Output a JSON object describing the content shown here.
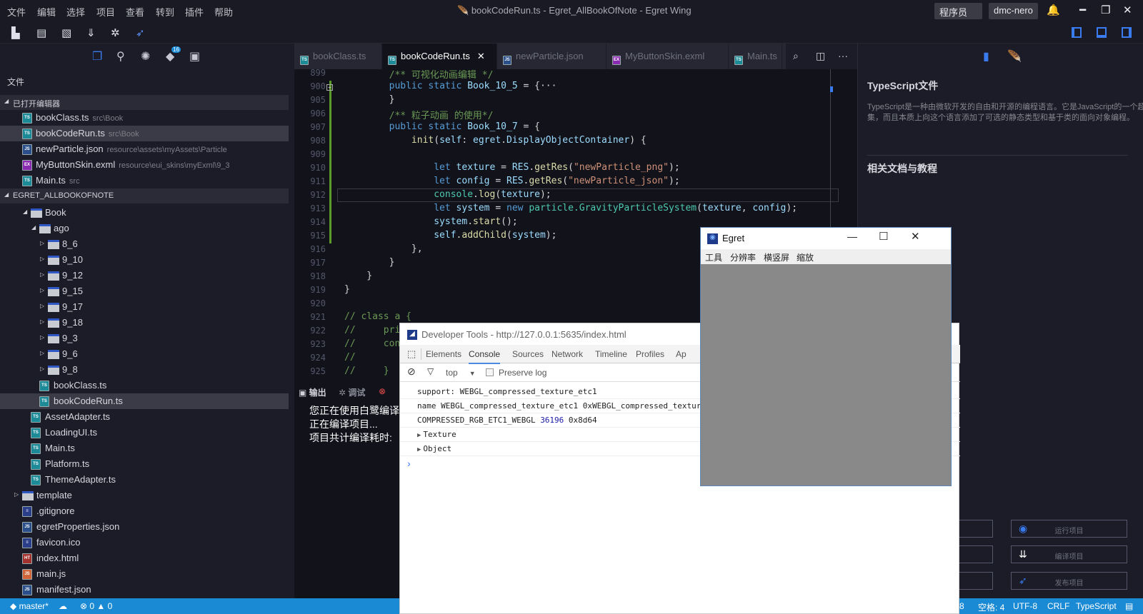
{
  "window": {
    "title": "bookCodeRun.ts - Egret_AllBookOfNote - Egret Wing",
    "menu": [
      "文件",
      "编辑",
      "选择",
      "项目",
      "查看",
      "转到",
      "插件",
      "帮助"
    ],
    "role_select": "程序员",
    "user": "dmc-nero"
  },
  "toolbar": {
    "icons": [
      "new-project-icon",
      "save-icon",
      "save-all-icon",
      "build-icon",
      "debug-icon",
      "publish-icon"
    ]
  },
  "activity": {
    "badge": "16"
  },
  "sidebar": {
    "title": "文件",
    "open_editors_header": "已打开编辑器",
    "open_editors": [
      {
        "name": "bookClass.ts",
        "path": "src\\Book",
        "type": "ts"
      },
      {
        "name": "bookCodeRun.ts",
        "path": "src\\Book",
        "type": "ts",
        "selected": true
      },
      {
        "name": "newParticle.json",
        "path": "resource\\assets\\myAssets\\Particle",
        "type": "json"
      },
      {
        "name": "MyButtonSkin.exml",
        "path": "resource\\eui_skins\\myExml\\9_3",
        "type": "exml"
      },
      {
        "name": "Main.ts",
        "path": "src",
        "type": "ts"
      }
    ],
    "project_header": "EGRET_ALLBOOKOFNOTE",
    "tree": [
      {
        "name": "Book",
        "kind": "folder",
        "depth": 1,
        "open": true
      },
      {
        "name": "ago",
        "kind": "folder",
        "depth": 2,
        "open": true
      },
      {
        "name": "8_6",
        "kind": "folder",
        "depth": 3
      },
      {
        "name": "9_10",
        "kind": "folder",
        "depth": 3
      },
      {
        "name": "9_12",
        "kind": "folder",
        "depth": 3
      },
      {
        "name": "9_15",
        "kind": "folder",
        "depth": 3
      },
      {
        "name": "9_17",
        "kind": "folder",
        "depth": 3
      },
      {
        "name": "9_18",
        "kind": "folder",
        "depth": 3
      },
      {
        "name": "9_3",
        "kind": "folder",
        "depth": 3
      },
      {
        "name": "9_6",
        "kind": "folder",
        "depth": 3
      },
      {
        "name": "9_8",
        "kind": "folder",
        "depth": 3
      },
      {
        "name": "bookClass.ts",
        "kind": "ts",
        "depth": 2
      },
      {
        "name": "bookCodeRun.ts",
        "kind": "ts",
        "depth": 2,
        "selected": true
      },
      {
        "name": "AssetAdapter.ts",
        "kind": "ts",
        "depth": 1
      },
      {
        "name": "LoadingUI.ts",
        "kind": "ts",
        "depth": 1
      },
      {
        "name": "Main.ts",
        "kind": "ts",
        "depth": 1
      },
      {
        "name": "Platform.ts",
        "kind": "ts",
        "depth": 1
      },
      {
        "name": "ThemeAdapter.ts",
        "kind": "ts",
        "depth": 1
      },
      {
        "name": "template",
        "kind": "folder",
        "depth": 0
      },
      {
        "name": ".gitignore",
        "kind": "text",
        "depth": 0
      },
      {
        "name": "egretProperties.json",
        "kind": "json",
        "depth": 0
      },
      {
        "name": "favicon.ico",
        "kind": "text",
        "depth": 0
      },
      {
        "name": "index.html",
        "kind": "html",
        "depth": 0
      },
      {
        "name": "main.js",
        "kind": "js",
        "depth": 0
      },
      {
        "name": "manifest.json",
        "kind": "json",
        "depth": 0
      }
    ]
  },
  "tabs": [
    {
      "label": "bookClass.ts",
      "type": "ts"
    },
    {
      "label": "bookCodeRun.ts",
      "type": "ts",
      "active": true,
      "close": "✕"
    },
    {
      "label": "newParticle.json",
      "type": "json"
    },
    {
      "label": "MyButtonSkin.exml",
      "type": "exml"
    },
    {
      "label": "Main.ts",
      "type": "ts"
    }
  ],
  "code": [
    {
      "n": "899",
      "t": [
        [
          "p",
          "        "
        ],
        [
          "c",
          "/** 可视化动画编辑 */"
        ]
      ]
    },
    {
      "n": "900",
      "fold": true,
      "t": [
        [
          "p",
          "        "
        ],
        [
          "k",
          "public static "
        ],
        [
          "i",
          "Book_10_5"
        ],
        [
          "p",
          " = {···"
        ]
      ]
    },
    {
      "n": "905",
      "t": [
        [
          "p",
          "        }"
        ]
      ]
    },
    {
      "n": "906",
      "t": [
        [
          "p",
          "        "
        ],
        [
          "c",
          "/** 粒子动画 的使用*/"
        ]
      ]
    },
    {
      "n": "907",
      "t": [
        [
          "p",
          "        "
        ],
        [
          "k",
          "public static "
        ],
        [
          "i",
          "Book_10_7"
        ],
        [
          "p",
          " = {"
        ]
      ]
    },
    {
      "n": "908",
      "t": [
        [
          "p",
          "            "
        ],
        [
          "f",
          "init"
        ],
        [
          "p",
          "("
        ],
        [
          "i",
          "self"
        ],
        [
          "p",
          ": "
        ],
        [
          "i",
          "egret"
        ],
        [
          "p",
          "."
        ],
        [
          "i",
          "DisplayObjectContainer"
        ],
        [
          "p",
          ") {"
        ]
      ]
    },
    {
      "n": "909",
      "t": []
    },
    {
      "n": "910",
      "t": [
        [
          "p",
          "                "
        ],
        [
          "k",
          "let "
        ],
        [
          "i",
          "texture"
        ],
        [
          "p",
          " = "
        ],
        [
          "i",
          "RES"
        ],
        [
          "p",
          "."
        ],
        [
          "f",
          "getRes"
        ],
        [
          "p",
          "("
        ],
        [
          "s",
          "\"newParticle_png\""
        ],
        [
          "p",
          ");"
        ]
      ]
    },
    {
      "n": "911",
      "t": [
        [
          "p",
          "                "
        ],
        [
          "k",
          "let "
        ],
        [
          "i",
          "config"
        ],
        [
          "p",
          " = "
        ],
        [
          "i",
          "RES"
        ],
        [
          "p",
          "."
        ],
        [
          "f",
          "getRes"
        ],
        [
          "p",
          "("
        ],
        [
          "s",
          "\"newParticle_json\""
        ],
        [
          "p",
          ");"
        ]
      ]
    },
    {
      "n": "912",
      "current": true,
      "t": [
        [
          "p",
          "                "
        ],
        [
          "t",
          "console"
        ],
        [
          "p",
          "."
        ],
        [
          "f",
          "log"
        ],
        [
          "p",
          "("
        ],
        [
          "i",
          "texture"
        ],
        [
          "p",
          ");"
        ]
      ]
    },
    {
      "n": "913",
      "t": [
        [
          "p",
          "                "
        ],
        [
          "k",
          "let "
        ],
        [
          "i",
          "system"
        ],
        [
          "p",
          " = "
        ],
        [
          "k",
          "new "
        ],
        [
          "t",
          "particle.GravityParticleSystem"
        ],
        [
          "p",
          "("
        ],
        [
          "i",
          "texture"
        ],
        [
          "p",
          ", "
        ],
        [
          "i",
          "config"
        ],
        [
          "p",
          ");"
        ]
      ]
    },
    {
      "n": "914",
      "t": [
        [
          "p",
          "                "
        ],
        [
          "i",
          "system"
        ],
        [
          "p",
          "."
        ],
        [
          "f",
          "start"
        ],
        [
          "p",
          "();"
        ]
      ]
    },
    {
      "n": "915",
      "t": [
        [
          "p",
          "                "
        ],
        [
          "i",
          "self"
        ],
        [
          "p",
          "."
        ],
        [
          "f",
          "addChild"
        ],
        [
          "p",
          "("
        ],
        [
          "i",
          "system"
        ],
        [
          "p",
          ");"
        ]
      ]
    },
    {
      "n": "916",
      "t": [
        [
          "p",
          "            },"
        ]
      ]
    },
    {
      "n": "917",
      "t": [
        [
          "p",
          "        }"
        ]
      ]
    },
    {
      "n": "918",
      "t": [
        [
          "p",
          "    }"
        ]
      ]
    },
    {
      "n": "919",
      "t": [
        [
          "p",
          "}"
        ]
      ]
    },
    {
      "n": "920",
      "t": []
    },
    {
      "n": "921",
      "t": [
        [
          "c",
          "// class a {"
        ]
      ]
    },
    {
      "n": "922",
      "t": [
        [
          "c",
          "//     pri"
        ]
      ]
    },
    {
      "n": "923",
      "t": [
        [
          "c",
          "//     con"
        ]
      ]
    },
    {
      "n": "924",
      "t": [
        [
          "c",
          "//"
        ]
      ]
    },
    {
      "n": "925",
      "t": [
        [
          "c",
          "//     }"
        ]
      ]
    }
  ],
  "panel": {
    "tabs": [
      "输出",
      "调试"
    ],
    "lines": [
      "您正在使用白鹭编译",
      "正在编译项目...",
      "项目共计编译耗时:"
    ]
  },
  "right_panel": {
    "title": "TypeScript文件",
    "desc1": "TypeScript是一种由微软开发的自由和开源的编程语言。它是JavaScript的一个超",
    "desc2": "集，而且本质上向这个语言添加了可选的静态类型和基于类的面向对象编程。",
    "related": "相关文档与教程",
    "buttons": [
      "运行项目",
      "编译项目",
      "发布项目"
    ]
  },
  "statusbar": {
    "branch": "master*",
    "errors": "0",
    "warnings": "0",
    "position": "8",
    "spaces": "空格: 4",
    "encoding": "UTF-8",
    "eol": "CRLF",
    "language": "TypeScript",
    "color": "#1a8ad4"
  },
  "devtools": {
    "title": "Developer Tools - http://127.0.0.1:5635/index.html",
    "tabs": [
      "Elements",
      "Console",
      "Sources",
      "Network",
      "Timeline",
      "Profiles",
      "Ap"
    ],
    "active_tab": "Console",
    "context": "top",
    "preserve_log": "Preserve log",
    "logs": [
      {
        "text": "support: WEBGL_compressed_texture_etc1"
      },
      {
        "text": "name WEBGL_compressed_texture_etc1 0xWEBGL_compressed_textur"
      },
      {
        "text": "COMPRESSED_RGB_ETC1_WEBGL ",
        "num": "36196",
        "rest": " 0x8d64"
      },
      {
        "text": "Texture",
        "expand": true
      },
      {
        "text": "Object",
        "expand": true
      }
    ],
    "prompt": "›"
  },
  "egret_window": {
    "title": "Egret",
    "menu": [
      "工具",
      "分辨率",
      "横竖屏",
      "缩放"
    ]
  }
}
